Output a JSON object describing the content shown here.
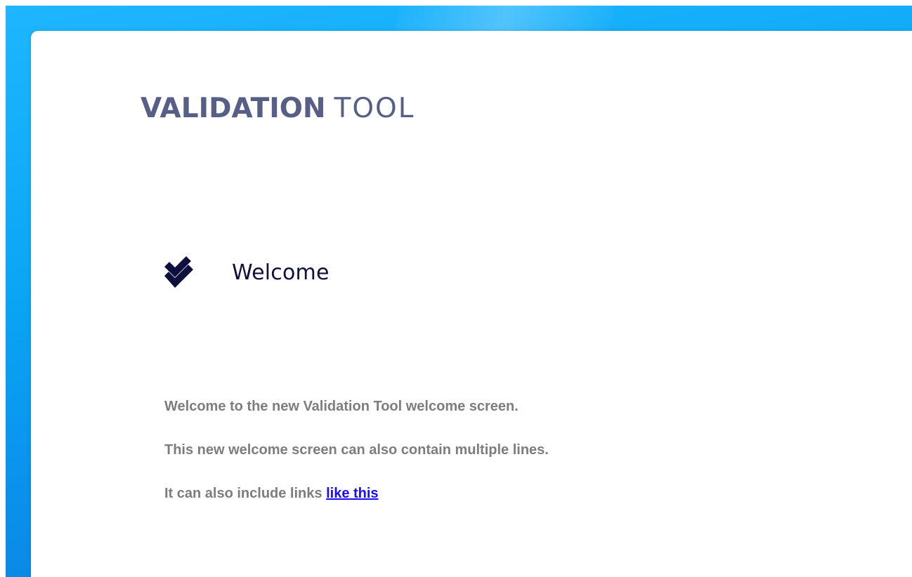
{
  "app": {
    "logo_strong": "VALIDATION",
    "logo_light": "TOOL"
  },
  "welcome": {
    "icon": "double-check-icon",
    "title": "Welcome",
    "lines": [
      "Welcome to the new Validation Tool welcome screen.",
      "This new welcome screen can also contain multiple lines."
    ],
    "link_line_prefix": "It can also include links ",
    "link_text": "like this"
  },
  "colors": {
    "desktop_accent": "#0aa5f4",
    "logo": "#575f86",
    "title": "#0f0f3d",
    "body_text": "#7d7d7d",
    "link": "#1a0dff"
  }
}
